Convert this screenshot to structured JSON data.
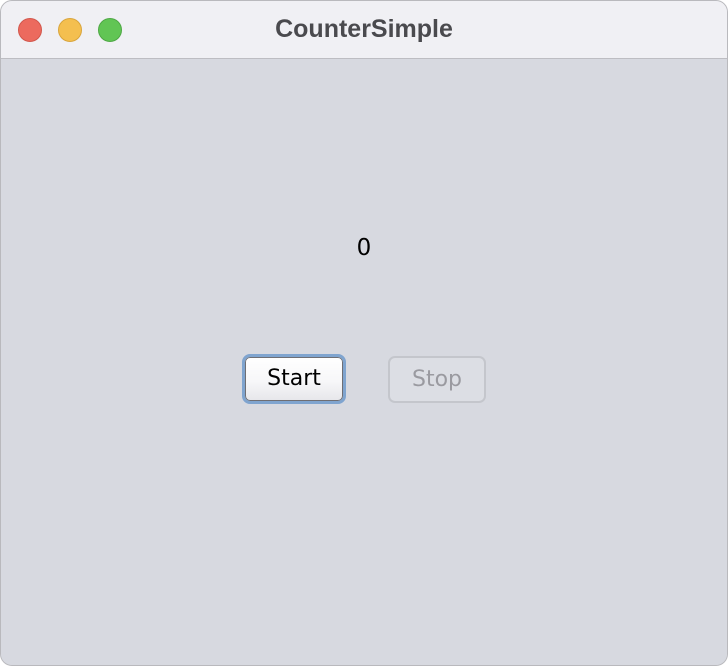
{
  "window": {
    "title": "CounterSimple",
    "controls": {
      "close_icon": "close-traffic-light",
      "minimize_icon": "minimize-traffic-light",
      "zoom_icon": "zoom-traffic-light",
      "close_color": "#ec6a5e",
      "minimize_color": "#f4bf4f",
      "zoom_color": "#61c554"
    }
  },
  "content": {
    "counter_value": "0",
    "start_label": "Start",
    "stop_label": "Stop",
    "stop_enabled": false,
    "start_focused": true
  }
}
